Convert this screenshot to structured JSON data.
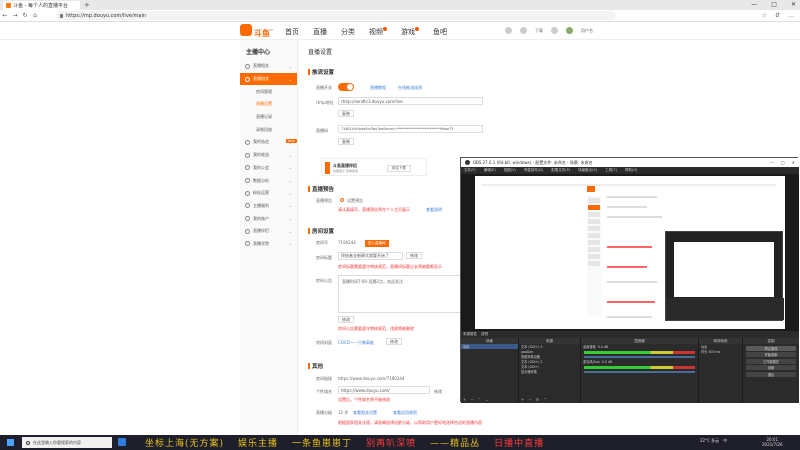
{
  "browser": {
    "tab_title": "斗鱼 - 每个人的直播平台",
    "new_tab": "+",
    "controls": [
      "—",
      "□",
      "✕"
    ],
    "url": "https://mp.douyu.com/live/main",
    "nav": [
      "←",
      "→",
      "↻",
      "⌂"
    ],
    "right_icons": [
      "☆",
      "⇵",
      "…"
    ]
  },
  "site": {
    "logo_text": "斗鱼",
    "logo_sub": "DOUYU.COM",
    "nav": [
      {
        "label": "首页",
        "badge": false
      },
      {
        "label": "直播",
        "badge": false
      },
      {
        "label": "分类",
        "badge": false
      },
      {
        "label": "视频",
        "badge": true
      },
      {
        "label": "游戏",
        "badge": true
      },
      {
        "label": "鱼吧",
        "badge": false
      }
    ],
    "right": {
      "download": "下载",
      "user": "用户名"
    }
  },
  "sidebar": {
    "title": "主播中心",
    "items": [
      {
        "label": "直播相关",
        "type": "group"
      },
      {
        "label": "直播相关",
        "type": "active"
      },
      {
        "label": "房间管理",
        "type": "sub"
      },
      {
        "label": "直播设置",
        "type": "subactive"
      },
      {
        "label": "直播记录",
        "type": "sub"
      },
      {
        "label": "录制回放",
        "type": "sub"
      },
      {
        "label": "我的私信",
        "type": "group",
        "tag": "NEW"
      },
      {
        "label": "我的收益",
        "type": "group"
      },
      {
        "label": "我的公会",
        "type": "group"
      },
      {
        "label": "数据分析",
        "type": "group"
      },
      {
        "label": "粉丝运营",
        "type": "group"
      },
      {
        "label": "主播福利",
        "type": "group"
      },
      {
        "label": "我的账户",
        "type": "group"
      },
      {
        "label": "直播伴侣",
        "type": "group"
      },
      {
        "label": "直播学院",
        "type": "group"
      }
    ]
  },
  "main": {
    "title": "直播设置",
    "sections": {
      "push": "推流设置",
      "preview": "直播预告",
      "room": "房间设置",
      "other": "其他"
    },
    "push": {
      "live_label": "直播开关",
      "tutorial": "直播教程",
      "connect_tutorial": "在线推流连线",
      "rtmp_label": "rtmp地址",
      "rtmp_value": "rtmp://sendtc3.douyu.com/live",
      "copy": "复制",
      "code_label": "直播码",
      "code_value": "7190244rYpdaSsvTwx?wsSecret=***************************tlwarT3",
      "copy2": "复制",
      "promo_title": "斗鱼直播伴侣",
      "promo_sub": "功能强大 简单易用",
      "promo_btn": "前往下载"
    },
    "preview": {
      "label": "直播预告",
      "radio_label": "设置预告",
      "note": "请认真填写，直播预告将在个人主页展示",
      "link": "查看说明"
    },
    "room": {
      "room_label": "房间号",
      "room_value": "7190244",
      "room_tag": "进入直播间",
      "title_label": "房间标题",
      "title_value": "终结者全新模式就要开始了",
      "title_edit": "修改",
      "title_warn": "房间标题需要遵守审核规范，直播间标题过长将被截断显示",
      "notice_label": "房间公告",
      "notice_value": "直播时间7:00-凌晨2点，欢迎关注",
      "notice_edit": "修改",
      "notice_warn": "房间公告需要遵守审核规范，违规将被删除",
      "cover_label": "房间封面",
      "cover_link": "COCO——只做高能",
      "cover_btn": "修改"
    },
    "other": {
      "link_label": "房间链接",
      "link_value": "https://www.douyu.com/7190244",
      "domain_label": "个性域名",
      "domain_value": "https://www.douyu.com/",
      "domain_suffix": "修改",
      "domain_note": "设置后，个性域名将不能修改",
      "age_label": "直播分级",
      "age_value": "12",
      "age_unit": "岁",
      "age_link1": "查看相关设置",
      "age_link2": "查看适用规则",
      "age_warn": "根据国家相关法规，请准确选择适龄分级，以帮助用户更好地选择合适的直播内容"
    }
  },
  "obs": {
    "title": "OBS 27.0.1 (64-bit, windows) - 配置文件: 未命名 - 场景: 未命名",
    "menu": [
      "文件(F)",
      "编辑(E)",
      "视图(V)",
      "停靠部件(D)",
      "配置文件(P)",
      "场景集合(S)",
      "工具(T)",
      "帮助(H)"
    ],
    "dock_tabs": [
      "来源属性",
      "滤镜"
    ],
    "panels": {
      "scenes": "场景",
      "sources": "来源",
      "mixer": "混音器",
      "transitions": "转场特效",
      "controls": "控制"
    },
    "scenes": [
      "场景"
    ],
    "sources": [
      "文本 (GDI+) 3",
      "gaoDan",
      "视频采集设备",
      "文本 (GDI+) 2",
      "文本 (GDI+)",
      "显示器采集"
    ],
    "mixer": [
      {
        "name": "桌面音频",
        "db": "0.0 dB"
      },
      {
        "name": "麦克风/Aux",
        "db": "0.0 dB"
      }
    ],
    "transition": {
      "type": "淡出",
      "duration_label": "时长",
      "duration": "300 ms"
    },
    "controls": [
      "停止推流",
      "开始录制",
      "工作室模式",
      "设置",
      "退出"
    ]
  },
  "taskbar": {
    "search": "在这里输入你要搜索的内容",
    "marquee": [
      {
        "text": "坐标上海(无方案)",
        "red": false
      },
      {
        "text": "娱乐主播",
        "red": false
      },
      {
        "text": "一条鱼崽崽丁",
        "red": false
      },
      {
        "text": "别再叭深喷",
        "red": true
      },
      {
        "text": "——精品丛",
        "red": false
      },
      {
        "text": "日播中直播",
        "red": true
      }
    ],
    "temp": "22°C 多云",
    "lang": "中",
    "time": "20:01",
    "date": "2021/7/26"
  },
  "colors": {
    "brand": "#ff6a00",
    "link": "#3a7bd5",
    "warn": "#e33333",
    "marquee": "#e8c21a"
  }
}
